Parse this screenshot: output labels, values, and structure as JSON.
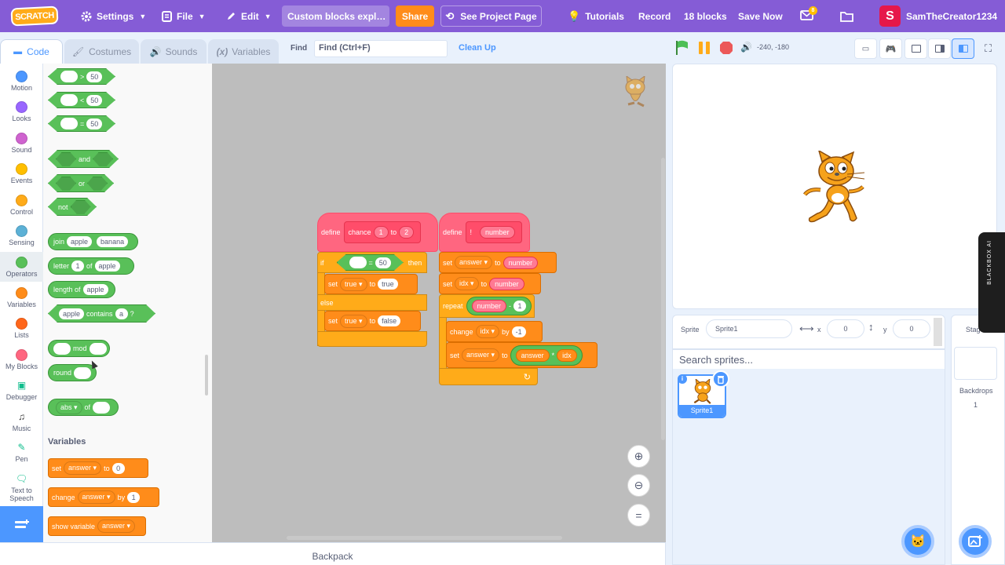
{
  "menubar": {
    "logo": "SCRATCH",
    "settings": "Settings",
    "file": "File",
    "edit": "Edit",
    "project_title": "Custom blocks expl…",
    "share": "Share",
    "see_project_page": "See Project Page",
    "tutorials": "Tutorials",
    "record": "Record",
    "blocks_count": "18 blocks",
    "save_now": "Save Now",
    "messages_badge": "8",
    "avatar_letter": "S",
    "username": "SamTheCreator1234"
  },
  "tabs": {
    "code": "Code",
    "costumes": "Costumes",
    "sounds": "Sounds",
    "variables": "Variables"
  },
  "find": {
    "label": "Find",
    "value": "Find (Ctrl+F)"
  },
  "clean_up": "Clean Up",
  "coords_readout": "-240, -180",
  "categories": [
    {
      "label": "Motion",
      "color": "#4c97ff"
    },
    {
      "label": "Looks",
      "color": "#9966ff"
    },
    {
      "label": "Sound",
      "color": "#cf63cf"
    },
    {
      "label": "Events",
      "color": "#ffbf00"
    },
    {
      "label": "Control",
      "color": "#ffab19"
    },
    {
      "label": "Sensing",
      "color": "#5cb1d6"
    },
    {
      "label": "Operators",
      "color": "#59c059"
    },
    {
      "label": "Variables",
      "color": "#ff8c1a"
    },
    {
      "label": "Lists",
      "color": "#ff661a"
    },
    {
      "label": "My Blocks",
      "color": "#ff6680"
    },
    {
      "label": "Debugger",
      "color": "#0fbd8c"
    },
    {
      "label": "Music",
      "color": "#0fbd8c"
    },
    {
      "label": "Pen",
      "color": "#0fbd8c"
    },
    {
      "label": "Text to Speech",
      "color": "#0fbd8c"
    }
  ],
  "palette": {
    "gt": ">",
    "lt": "<",
    "eq": "=",
    "fifty": "50",
    "and": "and",
    "or": "or",
    "not": "not",
    "join": "join",
    "apple": "apple",
    "banana": "banana",
    "letter": "letter",
    "one": "1",
    "of": "of",
    "length_of": "length of",
    "contains": "contains",
    "a": "a",
    "q": "?",
    "mod": "mod",
    "round": "round",
    "abs": "abs",
    "variables_title": "Variables",
    "set": "set",
    "answer": "answer",
    "to": "to",
    "zero": "0",
    "change": "change",
    "by": "by",
    "show_variable": "show variable"
  },
  "script1": {
    "define": "define",
    "chance": "chance",
    "one": "1",
    "to": "to",
    "two": "2",
    "if": "if",
    "eq": "=",
    "fifty": "50",
    "then": "then",
    "set": "set",
    "true": "true",
    "else": "else",
    "false": "false"
  },
  "script2": {
    "define": "define",
    "exclaim": "!",
    "number": "number",
    "set": "set",
    "answer": "answer",
    "to": "to",
    "idx": "idx",
    "repeat": "repeat",
    "minus": "-",
    "one": "1",
    "change": "change",
    "by": "by",
    "neg_one": "-1",
    "times": "*"
  },
  "backpack": "Backpack",
  "sprite_info": {
    "sprite_label": "Sprite",
    "sprite_name": "Sprite1",
    "x_label": "x",
    "x_value": "0",
    "y_label": "y",
    "y_value": "0"
  },
  "search_sprites": "Search sprites...",
  "sprite_tile": "Sprite1",
  "stage_pane": {
    "title": "Stage",
    "backdrops_label": "Backdrops",
    "backdrops_count": "1"
  },
  "blackbox": "BLACKBOX AI"
}
